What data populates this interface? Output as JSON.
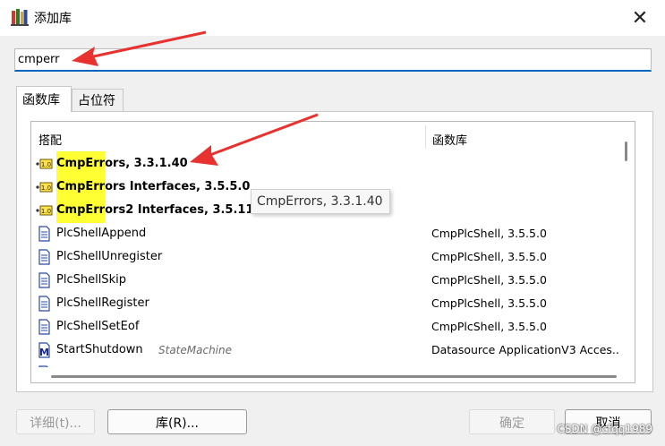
{
  "window": {
    "title": "添加库"
  },
  "search": {
    "value": "cmperr"
  },
  "tabs": [
    {
      "label": "函数库"
    },
    {
      "label": "占位符"
    }
  ],
  "list": {
    "columns": {
      "col1": "搭配",
      "col2": "函数库"
    },
    "rows": [
      {
        "pre": "",
        "highlight": "CmpErr",
        "post": "ors, 3.3.1.40",
        "hint": "",
        "lib": ""
      },
      {
        "pre": "",
        "highlight": "CmpErr",
        "post": "ors Interfaces, 3.5.5.0",
        "hint": "",
        "lib": ""
      },
      {
        "pre": "",
        "highlight": "CmpErr",
        "post": "ors2 Interfaces, 3.5.11.",
        "hint": "",
        "lib": ""
      },
      {
        "name": "PlcShellAppend",
        "hint": "",
        "lib": "CmpPlcShell, 3.5.5.0"
      },
      {
        "name": "PlcShellUnregister",
        "hint": "",
        "lib": "CmpPlcShell, 3.5.5.0"
      },
      {
        "name": "PlcShellSkip",
        "hint": "",
        "lib": "CmpPlcShell, 3.5.5.0"
      },
      {
        "name": "PlcShellRegister",
        "hint": "",
        "lib": "CmpPlcShell, 3.5.5.0"
      },
      {
        "name": "PlcShellSetEof",
        "hint": "",
        "lib": "CmpPlcShell, 3.5.5.0"
      },
      {
        "name": "StartShutdown",
        "hint": "StateMachine",
        "lib": "Datasource ApplicationV3 Acces..."
      }
    ],
    "library_badge": "1.0",
    "method_badge": "M"
  },
  "tooltip": {
    "text": "CmpErrors, 3.3.1.40"
  },
  "buttons": {
    "detail": "详细(t)...",
    "library": "库(R)...",
    "ok": "确定",
    "cancel": "取消"
  },
  "watermark": "CSDN @cfqq1989",
  "colors": {
    "highlight": "#ffff33",
    "accent": "#0067c0",
    "arrow": "#e8322f"
  }
}
